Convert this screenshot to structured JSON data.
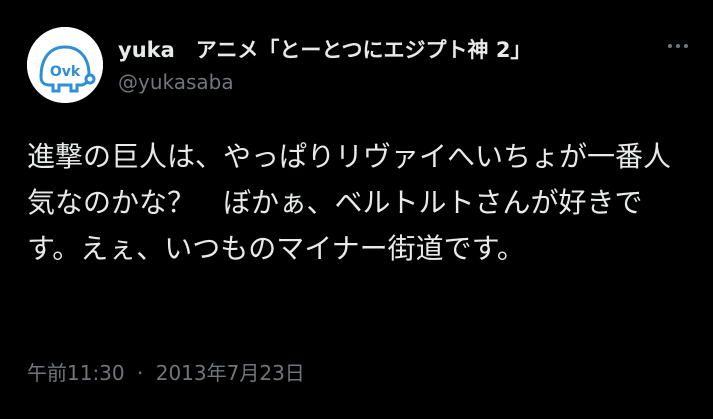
{
  "author": {
    "display_name": "yuka　アニメ「とーとつにエジプト神 2」",
    "handle": "@yukasaba",
    "avatar_text": "Ovk",
    "avatar_colors": {
      "background": "#ffffff",
      "mascot": "#2e8fd6"
    }
  },
  "more_icon": "more-horizontal-icon",
  "tweet": {
    "text": "進撃の巨人は、やっぱりリヴァイへいちょが一番人気なのかな？　ぼかぁ、ベルトルトさんが好きです。えぇ、いつものマイナー街道です。"
  },
  "timestamp": {
    "time": "午前11:30",
    "separator": "·",
    "date": "2013年7月23日"
  },
  "colors": {
    "background": "#000000",
    "primary_text": "#e7e9ea",
    "secondary_text": "#71767b"
  }
}
